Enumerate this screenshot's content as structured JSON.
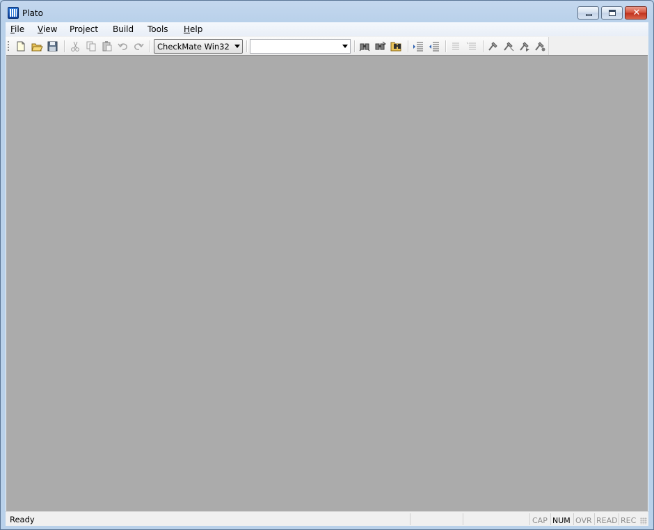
{
  "window": {
    "title": "Plato"
  },
  "menu": [
    {
      "label": "File",
      "mnemonic": "F"
    },
    {
      "label": "View",
      "mnemonic": "V"
    },
    {
      "label": "Project",
      "mnemonic": ""
    },
    {
      "label": "Build",
      "mnemonic": ""
    },
    {
      "label": "Tools",
      "mnemonic": ""
    },
    {
      "label": "Help",
      "mnemonic": "H"
    }
  ],
  "toolbar": {
    "buttons": [
      "new-file-icon",
      "open-folder-icon",
      "save-icon",
      "cut-icon",
      "copy-icon",
      "paste-icon",
      "undo-icon",
      "redo-icon",
      "find-icon",
      "find-replace-icon",
      "find-in-files-icon",
      "indent-icon",
      "outdent-icon",
      "comment-icon",
      "uncomment-icon",
      "build-icon",
      "compile-icon",
      "run-icon",
      "debug-icon"
    ],
    "config_combo": {
      "value": "CheckMate Win32"
    },
    "target_combo": {
      "value": ""
    }
  },
  "status": {
    "text": "Ready",
    "indicators": [
      {
        "label": "CAP",
        "active": false
      },
      {
        "label": "NUM",
        "active": true
      },
      {
        "label": "OVR",
        "active": false
      },
      {
        "label": "READ",
        "active": false
      },
      {
        "label": "REC",
        "active": false
      }
    ]
  },
  "colors": {
    "workspace": "#ababab",
    "frame": "#b9d1ea",
    "close_button": "#c0301c"
  }
}
